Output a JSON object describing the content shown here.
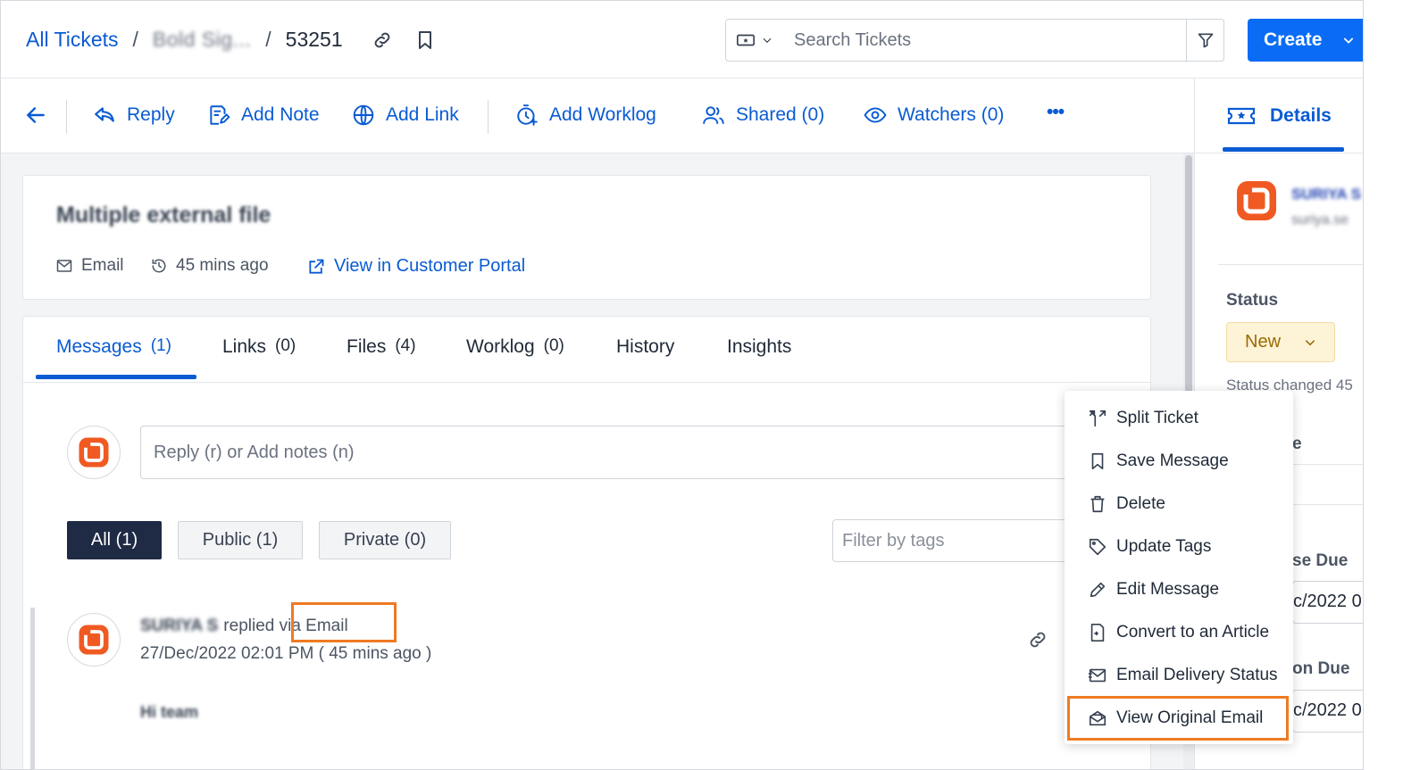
{
  "breadcrumb": {
    "root": "All Tickets",
    "separator": "/",
    "project": "Bold Sig...",
    "ticket_id": "53251"
  },
  "search": {
    "placeholder": "Search Tickets"
  },
  "create_button": {
    "label": "Create"
  },
  "toolbar": {
    "reply": "Reply",
    "add_note": "Add Note",
    "add_link": "Add Link",
    "add_worklog": "Add Worklog",
    "shared": "Shared (0)",
    "watchers": "Watchers (0)",
    "more": "•••"
  },
  "right_panel": {
    "details_tab": "Details",
    "requester_name": "SURIYA S",
    "requester_email": "suriya.se",
    "status_label": "Status",
    "status_value": "New",
    "status_changed": "Status changed 45",
    "partial_label": "e",
    "response_due_label": "se Due",
    "response_due_value": "c/2022 0",
    "resolution_due_label": "on Due",
    "resolution_due_value": "c/2022 0"
  },
  "ticket": {
    "title": "Multiple external file",
    "channel": "Email",
    "created": "45 mins ago",
    "portal_link": "View in Customer Portal"
  },
  "tabs": [
    {
      "label": "Messages",
      "count": "(1)"
    },
    {
      "label": "Links",
      "count": "(0)"
    },
    {
      "label": "Files",
      "count": "(4)"
    },
    {
      "label": "Worklog",
      "count": "(0)"
    },
    {
      "label": "History",
      "count": ""
    },
    {
      "label": "Insights",
      "count": ""
    }
  ],
  "reply_box": {
    "placeholder": "Reply (r) or Add notes (n)"
  },
  "filters": {
    "all": "All (1)",
    "public": "Public (1)",
    "private": "Private (0)",
    "tag_placeholder": "Filter by tags"
  },
  "message": {
    "author": "SURIYA S",
    "replied_via": "replied via Email",
    "date": "27/Dec/2022 02:01 PM ( 45 mins ago )",
    "body": "Hi team"
  },
  "menu": {
    "items": [
      {
        "label": "Split Ticket",
        "icon": "split-icon"
      },
      {
        "label": "Save Message",
        "icon": "bookmark-icon"
      },
      {
        "label": "Delete",
        "icon": "trash-icon"
      },
      {
        "label": "Update Tags",
        "icon": "tag-icon"
      },
      {
        "label": "Edit Message",
        "icon": "pencil-icon"
      },
      {
        "label": "Convert to an Article",
        "icon": "article-icon"
      },
      {
        "label": "Email Delivery Status",
        "icon": "email-status-icon"
      },
      {
        "label": "View Original Email",
        "icon": "open-envelope-icon"
      }
    ]
  },
  "colors": {
    "primary": "#0a5bd3",
    "create_button": "#0a6cf5",
    "highlight": "#ef7a22",
    "status_bg": "#fdf3d7",
    "status_text": "#9a6b00",
    "brand_orange": "#f05a22"
  }
}
